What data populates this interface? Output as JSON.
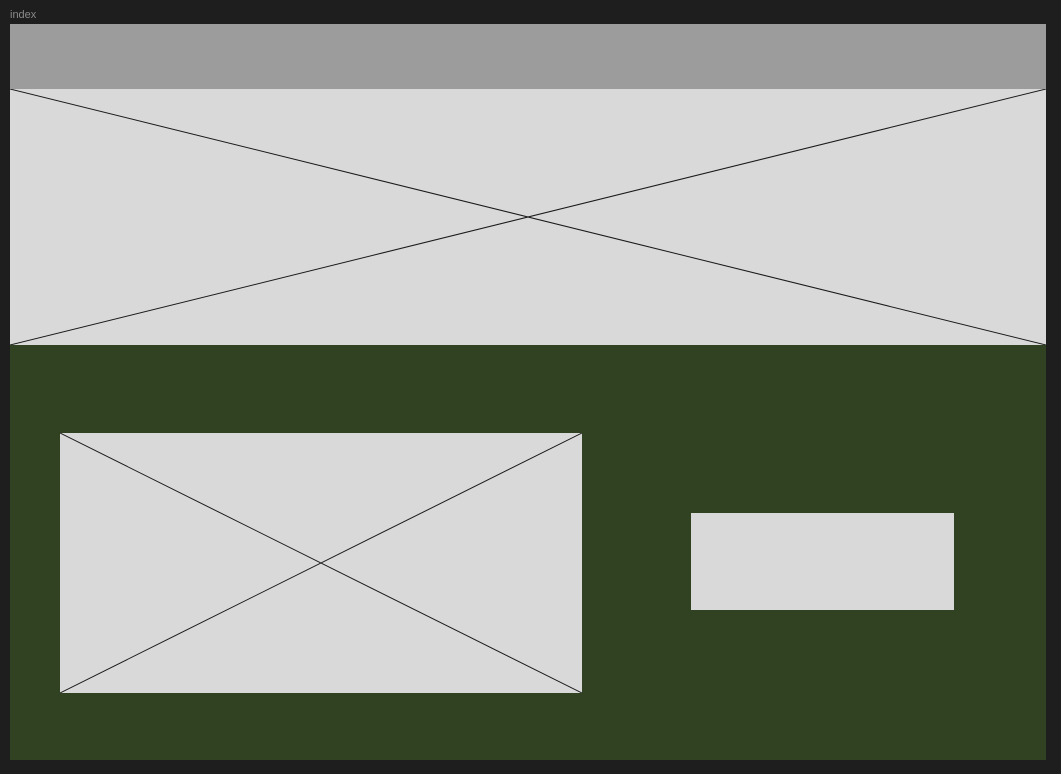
{
  "frame": {
    "label": "index"
  },
  "colors": {
    "canvas_background": "#1e1e1e",
    "frame_label": "#8a8a8a",
    "header_bar": "#9c9c9c",
    "placeholder_fill": "#d9d9d9",
    "placeholder_line": "#1a1a1a",
    "content_section": "#314222"
  },
  "icons": {
    "hero": "image-placeholder-icon",
    "content_image": "image-placeholder-icon"
  }
}
